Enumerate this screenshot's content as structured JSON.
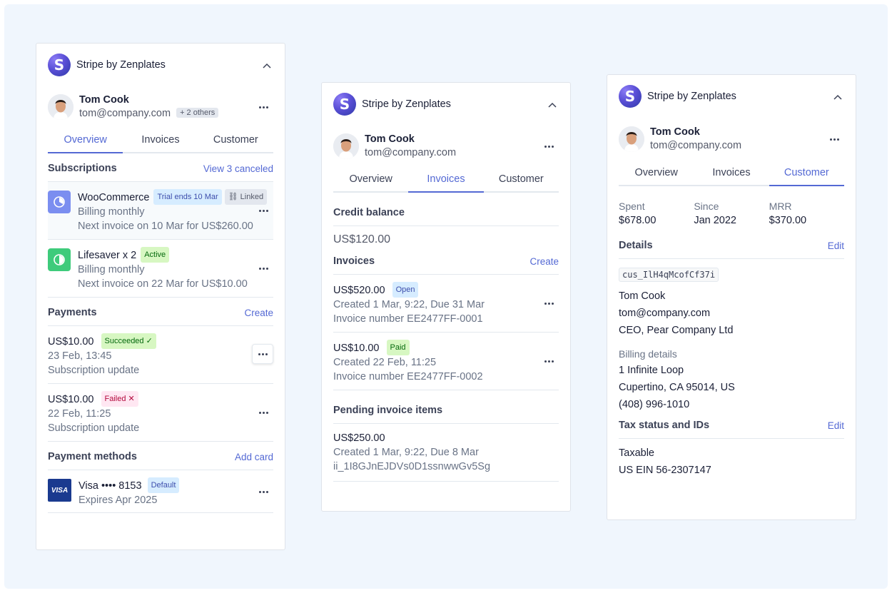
{
  "app": {
    "name": "Stripe by Zenplates",
    "logo_letter": "S"
  },
  "user": {
    "name": "Tom Cook",
    "email": "tom@company.com",
    "others_badge": "+ 2 others"
  },
  "tabs": [
    "Overview",
    "Invoices",
    "Customer"
  ],
  "overview": {
    "subscriptions": {
      "title": "Subscriptions",
      "link": "View 3 canceled",
      "items": [
        {
          "name": "WooCommerce",
          "badge": "Trial ends 10 Mar",
          "badge2": "Linked",
          "billing": "Billing monthly",
          "next": "Next invoice on 10 Mar for US$260.00",
          "icon_color": "#7b8ef0"
        },
        {
          "name": "Lifesaver x 2",
          "badge": "Active",
          "billing": "Billing monthly",
          "next": "Next invoice on 22 Mar for US$10.00",
          "icon_color": "#3ecb7b"
        }
      ]
    },
    "payments": {
      "title": "Payments",
      "link": "Create",
      "items": [
        {
          "amount": "US$10.00",
          "status": "Succeeded",
          "date": "23 Feb, 13:45",
          "desc": "Subscription update"
        },
        {
          "amount": "US$10.00",
          "status": "Failed",
          "date": "22 Feb, 11:25",
          "desc": "Subscription update"
        }
      ]
    },
    "payment_methods": {
      "title": "Payment methods",
      "link": "Add card",
      "items": [
        {
          "brand": "VISA",
          "label": "Visa •••• 8153",
          "badge": "Default",
          "expires": "Expires Apr 2025"
        }
      ]
    }
  },
  "invoices_tab": {
    "credit": {
      "title": "Credit balance",
      "amount": "US$120.00"
    },
    "invoices": {
      "title": "Invoices",
      "link": "Create",
      "items": [
        {
          "amount": "US$520.00",
          "status": "Open",
          "created": "Created 1 Mar, 9:22, Due 31 Mar",
          "number": "Invoice number EE2477FF-0001"
        },
        {
          "amount": "US$10.00",
          "status": "Paid",
          "created": "Created 22 Feb, 11:25",
          "number": "Invoice number EE2477FF-0002"
        }
      ]
    },
    "pending": {
      "title": "Pending invoice items",
      "items": [
        {
          "amount": "US$250.00",
          "created": "Created 1 Mar, 9:22, Due 8 Mar",
          "id": "ii_1I8GJnEJDVs0D1ssnwwGv5Sg"
        }
      ]
    }
  },
  "customer_tab": {
    "stats": [
      {
        "label": "Spent",
        "value": "$678.00"
      },
      {
        "label": "Since",
        "value": "Jan 2022"
      },
      {
        "label": "MRR",
        "value": "$370.00"
      }
    ],
    "details": {
      "title": "Details",
      "link": "Edit",
      "customer_id": "cus_IlH4qMcofCf37i",
      "name": "Tom Cook",
      "email": "tom@company.com",
      "company": "CEO, Pear Company Ltd",
      "billing_label": "Billing details",
      "address1": "1 Infinite Loop",
      "address2": "Cupertino, CA 95014, US",
      "phone": "(408) 996-1010"
    },
    "tax": {
      "title": "Tax status and IDs",
      "link": "Edit",
      "status": "Taxable",
      "ein": "US EIN 56-2307147"
    }
  },
  "colors": {
    "accent": "#5469d4",
    "background": "#f0f6fd",
    "logo": "#5a4fd6"
  }
}
